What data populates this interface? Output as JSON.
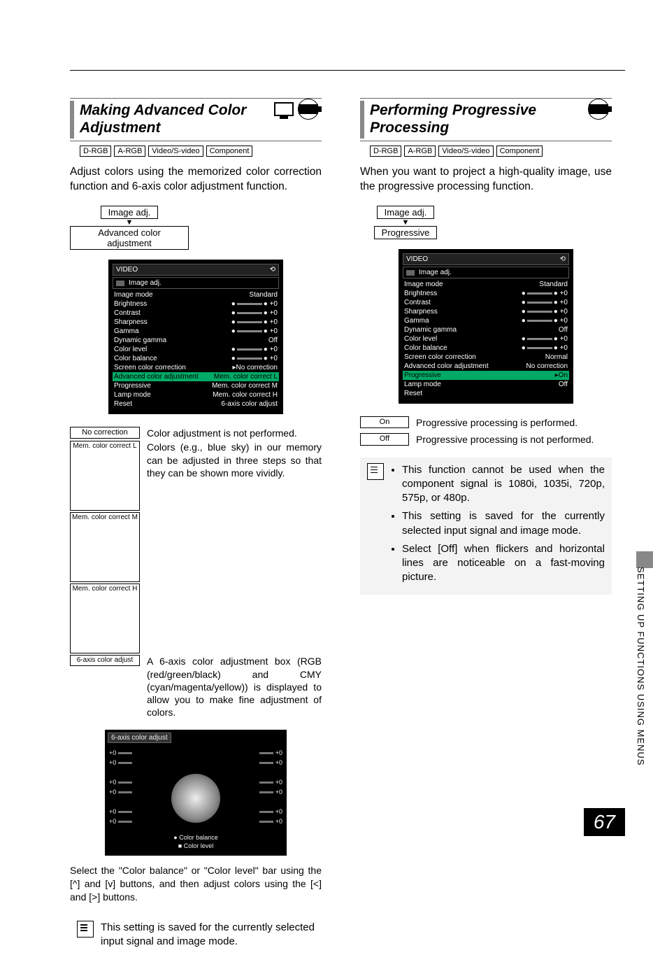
{
  "page_number": "67",
  "side_label": "SETTING UP FUNCTIONS USING MENUS",
  "left": {
    "title": "Making Advanced Color Adjustment",
    "tags": [
      "D-RGB",
      "A-RGB",
      "Video/S-video",
      "Component"
    ],
    "intro": "Adjust colors using the memorized color correction function and 6-axis color adjustment function.",
    "nav1": "Image adj.",
    "nav2": "Advanced color adjustment",
    "menu": {
      "header1": "VIDEO",
      "header2": "Image adj.",
      "rows": [
        {
          "l": "Image mode",
          "r": "Standard"
        },
        {
          "l": "Brightness",
          "r": "+0",
          "slider": true
        },
        {
          "l": "Contrast",
          "r": "+0",
          "slider": true
        },
        {
          "l": "Sharpness",
          "r": "+0",
          "slider": true
        },
        {
          "l": "Gamma",
          "r": "+0",
          "slider": true
        },
        {
          "l": "Dynamic gamma",
          "r": "Off"
        },
        {
          "l": "Color level",
          "r": "+0",
          "slider": true
        },
        {
          "l": "Color balance",
          "r": "+0",
          "slider": true
        },
        {
          "l": "Screen color correction",
          "r": "▸No correction"
        },
        {
          "l": "Advanced color adjustment",
          "r": "Mem. color correct L",
          "hl": true
        },
        {
          "l": "Progressive",
          "r": "Mem. color correct M"
        },
        {
          "l": "Lamp mode",
          "r": "Mem. color correct H"
        },
        {
          "l": "Reset",
          "r": "6-axis color adjust"
        }
      ]
    },
    "options": [
      {
        "label": "No correction",
        "desc": "Color adjustment is not performed."
      },
      {
        "label": "Mem. color correct L",
        "sm": true,
        "rowspan_desc": "Colors (e.g., blue sky) in our memory can be adjusted in three steps so that they can be shown more vividly."
      },
      {
        "label": "Mem. color correct M",
        "sm": true
      },
      {
        "label": "Mem. color correct H",
        "sm": true
      },
      {
        "label": "6-axis color adjust",
        "sm": true,
        "desc": "A 6-axis color adjustment box (RGB (red/green/black) and CMY (cyan/magenta/yellow)) is displayed to allow you to make fine adjustment of colors."
      }
    ],
    "sixaxis": {
      "title": "6-axis color adjust",
      "legend1": "Color balance",
      "legend2": "Color level"
    },
    "after_six": "Select the \"Color balance\" or \"Color level\" bar using the [^] and [v] buttons, and then adjust colors using the [<] and [>] buttons.",
    "note": "This setting is saved for the currently selected input signal and image mode."
  },
  "right": {
    "title": "Performing Progressive Processing",
    "tags": [
      "D-RGB",
      "A-RGB",
      "Video/S-video",
      "Component"
    ],
    "intro": "When you want to project a high-quality image, use the progressive processing function.",
    "nav1": "Image adj.",
    "nav2": "Progressive",
    "menu": {
      "header1": "VIDEO",
      "header2": "Image adj.",
      "rows": [
        {
          "l": "Image mode",
          "r": "Standard"
        },
        {
          "l": "Brightness",
          "r": "+0",
          "slider": true
        },
        {
          "l": "Contrast",
          "r": "+0",
          "slider": true
        },
        {
          "l": "Sharpness",
          "r": "+0",
          "slider": true
        },
        {
          "l": "Gamma",
          "r": "+0",
          "slider": true
        },
        {
          "l": "Dynamic gamma",
          "r": "Off"
        },
        {
          "l": "Color level",
          "r": "+0",
          "slider": true
        },
        {
          "l": "Color balance",
          "r": "+0",
          "slider": true
        },
        {
          "l": "Screen color correction",
          "r": "Normal"
        },
        {
          "l": "Advanced color adjustment",
          "r": "No correction"
        },
        {
          "l": "Progressive",
          "r": "▸On",
          "hl": true
        },
        {
          "l": "Lamp mode",
          "r": "Off"
        },
        {
          "l": "Reset",
          "r": ""
        }
      ]
    },
    "options": [
      {
        "label": "On",
        "desc": "Progressive processing is performed."
      },
      {
        "label": "Off",
        "desc": "Progressive processing is not performed."
      }
    ],
    "notes": [
      "This function cannot be used when the component signal is 1080i, 1035i, 720p, 575p, or 480p.",
      "This setting is saved for the currently selected input signal and image mode.",
      "Select [Off] when flickers and horizontal lines are noticeable on a fast-moving picture."
    ]
  }
}
